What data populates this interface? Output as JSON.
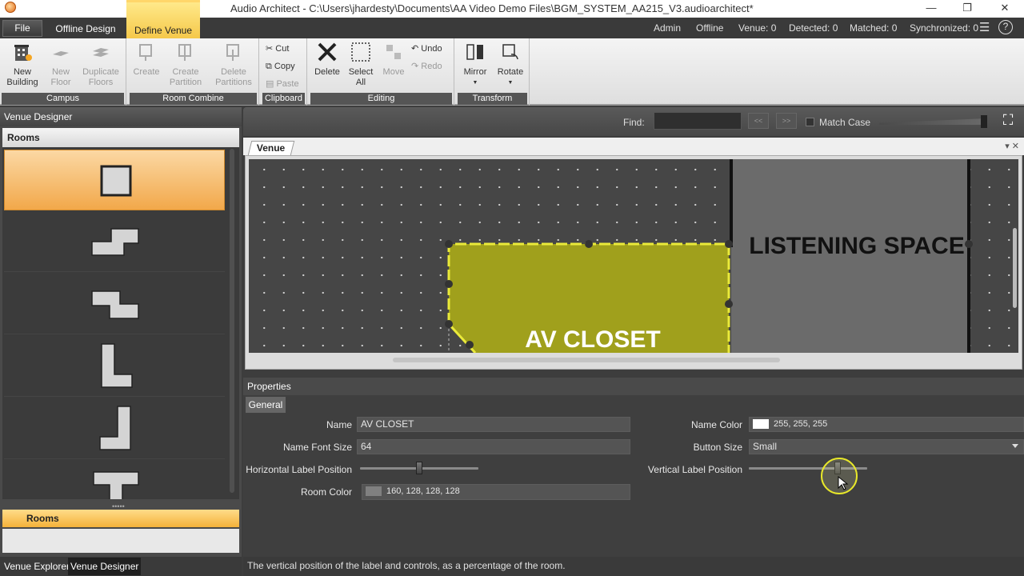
{
  "window": {
    "title": "Audio Architect - C:\\Users\\jhardesty\\Documents\\AA Video Demo Files\\BGM_SYSTEM_AA215_V3.audioarchitect*",
    "minimize": "—",
    "maximize": "❐",
    "close": "✕"
  },
  "menu": {
    "file": "File",
    "tabs": [
      "Offline Design",
      "Define Venue"
    ],
    "active_tab": "Define Venue"
  },
  "status": {
    "user": "Admin",
    "mode": "Offline",
    "venue": "Venue: 0",
    "detected": "Detected: 0",
    "matched": "Matched: 0",
    "synchronized": "Synchronized: 0"
  },
  "ribbon": {
    "campus": {
      "label": "Campus",
      "new_building": "New\nBuilding",
      "new_floor": "New\nFloor",
      "duplicate_floors": "Duplicate\nFloors"
    },
    "room_combine": {
      "label": "Room Combine",
      "create": "Create",
      "create_partition": "Create\nPartition",
      "delete_partitions": "Delete\nPartitions"
    },
    "clipboard": {
      "label": "Clipboard",
      "cut": "Cut",
      "copy": "Copy",
      "paste": "Paste"
    },
    "editing": {
      "label": "Editing",
      "delete": "Delete",
      "select_all": "Select\nAll",
      "move": "Move",
      "undo": "Undo",
      "redo": "Redo"
    },
    "transform": {
      "label": "Transform",
      "mirror": "Mirror",
      "rotate": "Rotate"
    }
  },
  "left_panel": {
    "title": "Venue Designer",
    "rooms_header": "Rooms",
    "room_shapes": [
      "square",
      "z-shape",
      "s-shape",
      "l-shape",
      "j-shape",
      "t-shape"
    ],
    "selected_index": 0,
    "rooms_bar": "Rooms",
    "bottom_tabs": [
      "Venue Explorer",
      "Venue Designer"
    ],
    "active_bottom_tab": "Venue Designer"
  },
  "find": {
    "label": "Find:",
    "value": "",
    "prev": "<<",
    "next": ">>",
    "match_case": "Match Case",
    "match_case_checked": false
  },
  "document": {
    "tab": "Venue"
  },
  "canvas": {
    "rooms": [
      {
        "name": "AV CLOSET",
        "color": "#a0a01c",
        "selected": true
      },
      {
        "name": "LISTENING SPACE",
        "color": "#6b6b6b",
        "selected": false
      }
    ]
  },
  "properties": {
    "header": "Properties",
    "tab": "General",
    "name_label": "Name",
    "name_value": "AV CLOSET",
    "font_size_label": "Name Font Size",
    "font_size_value": "64",
    "hlabel_label": "Horizontal Label Position",
    "hlabel_value": 0.5,
    "room_color_label": "Room Color",
    "room_color_value": "160, 128, 128, 128",
    "name_color_label": "Name Color",
    "name_color_value": "255, 255, 255",
    "button_size_label": "Button Size",
    "button_size_value": "Small",
    "vlabel_label": "Vertical Label Position",
    "vlabel_value": 0.75
  },
  "statusbar": {
    "text": "The vertical position of the label and controls, as a percentage of the room."
  }
}
